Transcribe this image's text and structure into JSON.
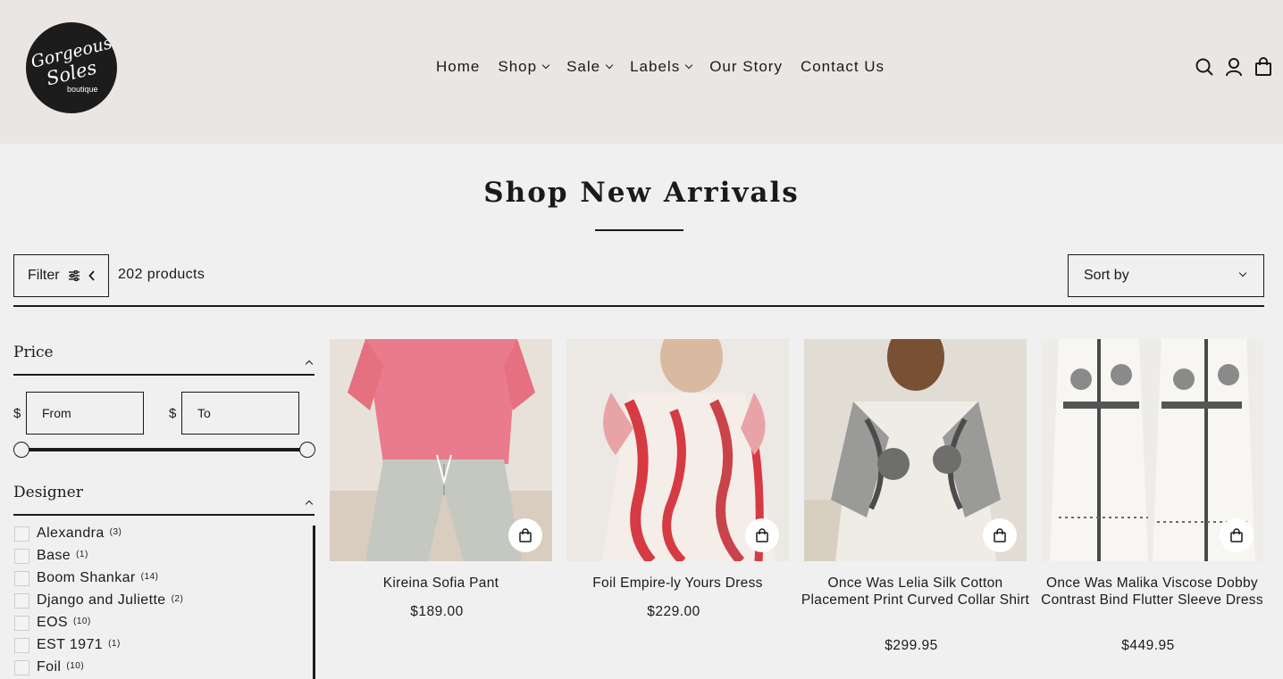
{
  "logo": {
    "line1": "Gorgeous",
    "line2": "Soles",
    "line3": "boutique"
  },
  "nav": {
    "home": "Home",
    "shop": "Shop",
    "sale": "Sale",
    "labels": "Labels",
    "our_story": "Our Story",
    "contact": "Contact Us"
  },
  "header_icons": [
    "search-icon",
    "account-icon",
    "cart-icon"
  ],
  "page_title": "Shop New Arrivals",
  "toolbar": {
    "filter_label": "Filter",
    "product_count": "202 products",
    "sort_label": "Sort by"
  },
  "price_filter": {
    "title": "Price",
    "currency": "$",
    "from_placeholder": "From",
    "to_placeholder": "To"
  },
  "designer_filter": {
    "title": "Designer",
    "items": [
      {
        "name": "Alexandra",
        "count": "(3)"
      },
      {
        "name": "Base",
        "count": "(1)"
      },
      {
        "name": "Boom Shankar",
        "count": "(14)"
      },
      {
        "name": "Django and Juliette",
        "count": "(2)"
      },
      {
        "name": "EOS",
        "count": "(10)"
      },
      {
        "name": "EST 1971",
        "count": "(1)"
      },
      {
        "name": "Foil",
        "count": "(10)"
      }
    ]
  },
  "products": [
    {
      "name": "Kireina Sofia Pant",
      "price": "$189.00"
    },
    {
      "name": "Foil Empire-ly Yours Dress",
      "price": "$229.00"
    },
    {
      "name": "Once Was Lelia Silk Cotton Placement Print Curved Collar Shirt",
      "price": "$299.95"
    },
    {
      "name": "Once Was Malika Viscose Dobby Contrast Bind Flutter Sleeve Dress",
      "price": "$449.95"
    }
  ],
  "colors": {
    "header_bg": "#e9e6e4",
    "page_bg": "#f1f0f0",
    "text": "#1a1a1a"
  }
}
